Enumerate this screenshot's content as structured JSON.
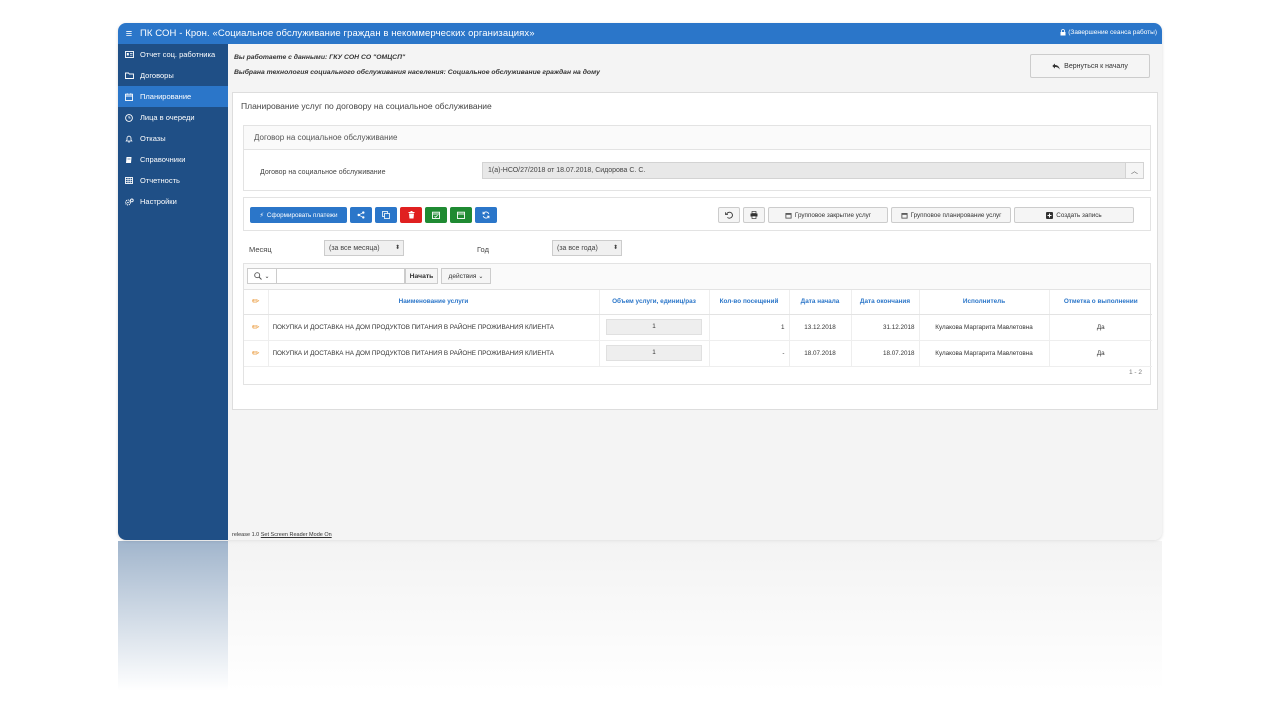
{
  "app": {
    "title": "ПК СОН - Крон. «Социальное обслуживание граждан в некоммерческих организациях»",
    "logout": "(Завершение сеанса работы)"
  },
  "sidebar": {
    "items": [
      {
        "label": "Отчет соц. работника",
        "icon": "id-card-icon"
      },
      {
        "label": "Договоры",
        "icon": "folder-icon"
      },
      {
        "label": "Планирование",
        "icon": "calendar-icon",
        "active": true
      },
      {
        "label": "Лица в очереди",
        "icon": "clock-icon"
      },
      {
        "label": "Отказы",
        "icon": "bell-icon"
      },
      {
        "label": "Справочники",
        "icon": "book-icon"
      },
      {
        "label": "Отчетность",
        "icon": "table-icon"
      },
      {
        "label": "Настройки",
        "icon": "gears-icon"
      }
    ]
  },
  "header": {
    "working_data": "Вы работаете с данными: ГКУ СОН СО \"ОМЦСП\"",
    "technology": "Выбрана технология социального обслуживания населения: Социальное обслуживание граждан на дому",
    "back_label": "Вернуться к началу"
  },
  "panel": {
    "title": "Планирование услуг по договору на социальное обслуживание",
    "contract_section_title": "Договор на социальное обслуживание",
    "contract_label": "Договор на социальное обслуживание",
    "contract_value": "1(а)-НСО/27/2018 от 18.07.2018, Сидорова С. С."
  },
  "toolbar": {
    "generate_payments_label": "Сформировать платежи",
    "group_close_label": "Групповое закрытие услуг",
    "group_plan_label": "Групповое планирование услуг",
    "create_record_label": "Создать запись",
    "colors": {
      "blue": "#2b76c9",
      "red": "#e02020",
      "green": "#1f8a32"
    }
  },
  "filters": {
    "month_label": "Месяц",
    "month_value": "(за все месяца)",
    "year_label": "Год",
    "year_value": "(за все года)"
  },
  "grid": {
    "search_placeholder": "",
    "start_label": "Начать",
    "actions_label": "действия",
    "columns": [
      "Наименование услуги",
      "Объем услуги, единиц/раз",
      "Кол-во посещений",
      "Дата начала",
      "Дата окончания",
      "Исполнитель",
      "Отметка о выполнении"
    ],
    "rows": [
      {
        "name": "ПОКУПКА И ДОСТАВКА НА ДОМ ПРОДУКТОВ ПИТАНИЯ В РАЙОНЕ ПРОЖИВАНИЯ КЛИЕНТА",
        "volume": "1",
        "visits": "1",
        "start": "13.12.2018",
        "end": "31.12.2018",
        "executor": "Кулакова Маргарита Мавлетовна",
        "done": "Да"
      },
      {
        "name": "ПОКУПКА И ДОСТАВКА НА ДОМ ПРОДУКТОВ ПИТАНИЯ В РАЙОНЕ ПРОЖИВАНИЯ КЛИЕНТА",
        "volume": "1",
        "visits": "-",
        "start": "18.07.2018",
        "end": "18.07.2018",
        "executor": "Кулакова Маргарита Мавлетовна",
        "done": "Да"
      }
    ],
    "pager": "1 - 2"
  },
  "footer": {
    "release": "release 1.0",
    "reader_link": "Set Screen Reader Mode On"
  }
}
